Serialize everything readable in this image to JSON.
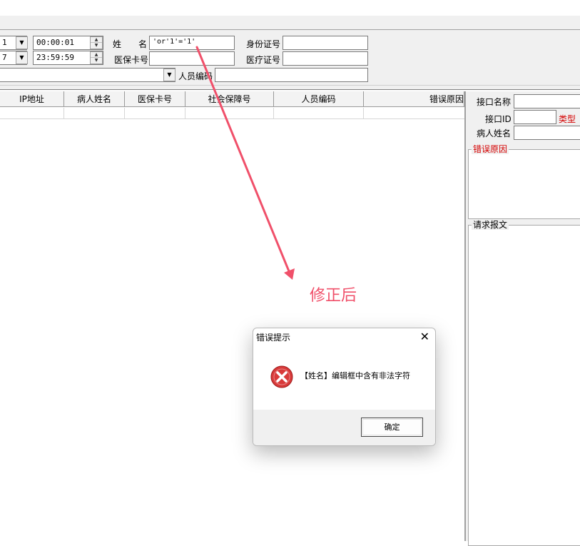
{
  "filter": {
    "start_date_partial": "1",
    "end_date_partial": "7",
    "start_time": "00:00:01",
    "end_time": "23:59:59",
    "name_label": "姓　　名",
    "name_value": "'or'1'='1'",
    "id_label": "身份证号",
    "id_value": "",
    "insurance_card_label": "医保卡号",
    "insurance_card_value": "",
    "medical_cert_label": "医疗证号",
    "medical_cert_value": "",
    "dropdown_value": "",
    "staff_code_label": "人员编码",
    "staff_code_value": ""
  },
  "grid": {
    "columns": [
      "IP地址",
      "病人姓名",
      "医保卡号",
      "社会保障号",
      "人员编码",
      "错误原因"
    ]
  },
  "detail": {
    "interface_name_label": "接口名称",
    "interface_name_value": "",
    "interface_id_label": "接口ID",
    "interface_id_value": "",
    "type_label": "类型",
    "patient_name_label": "病人姓名",
    "patient_name_value": "",
    "error_reason_title": "错误原因",
    "request_message_title": "请求报文"
  },
  "annotation": {
    "text": "修正后",
    "color": "#f0506a"
  },
  "dialog": {
    "title": "错误提示",
    "close_glyph": "✕",
    "message": "【姓名】编辑框中含有非法字符",
    "ok_label": "确定",
    "icon": "error-icon"
  }
}
